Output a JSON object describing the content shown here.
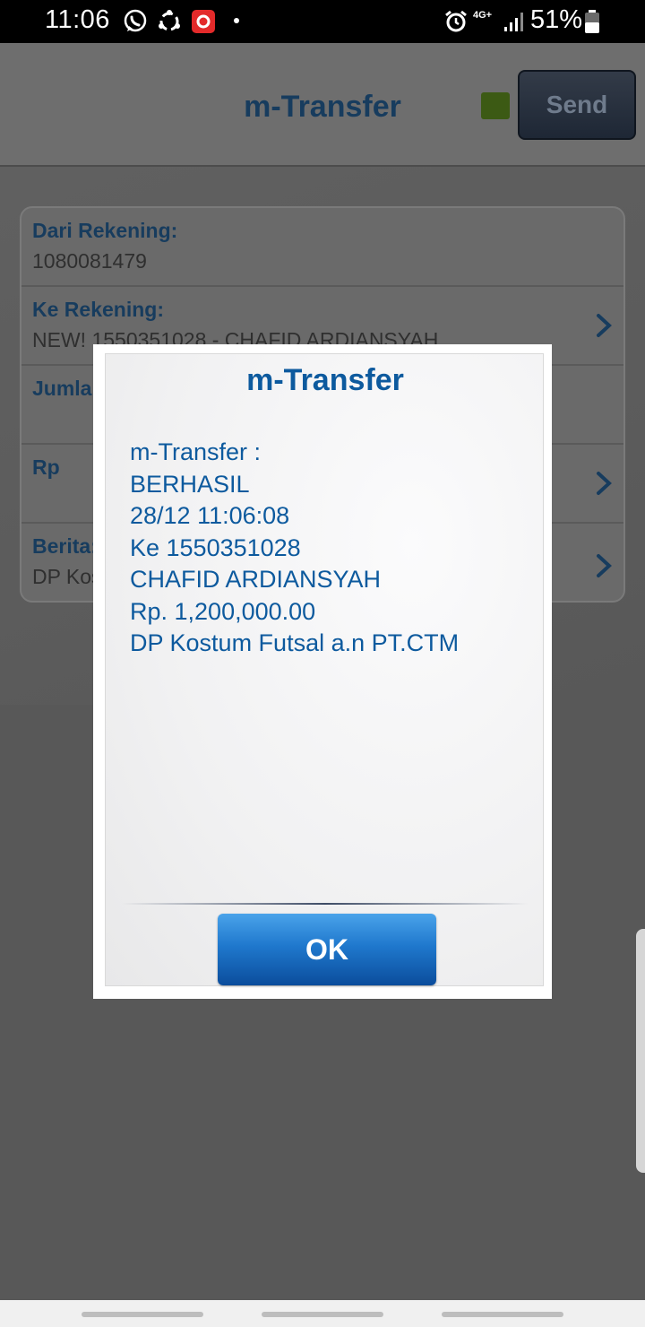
{
  "status_bar": {
    "time": "11:06",
    "battery": "51%",
    "network": "4G+",
    "icons": [
      "whatsapp-icon",
      "sync-icon",
      "recorder-icon",
      "alarm-icon",
      "signal-icon",
      "battery-icon"
    ]
  },
  "header": {
    "title": "m-Transfer",
    "send_label": "Send",
    "status_led_color": "#3c5a14"
  },
  "form": {
    "rows": [
      {
        "label": "Dari Rekening:",
        "value": "1080081479"
      },
      {
        "label": "Ke Rekening:",
        "value": "NEW! 1550351028 - CHAFID ARDIANSYAH"
      },
      {
        "label": "Jumlah:",
        "value": ""
      },
      {
        "label": "Rp",
        "value": ""
      },
      {
        "label": "Berita:",
        "value": "DP Kostum Futsal a.n PT.CTM"
      }
    ]
  },
  "dialog": {
    "title": "m-Transfer",
    "lines": [
      "m-Transfer :",
      "BERHASIL",
      "28/12 11:06:08",
      "Ke 1550351028",
      "CHAFID ARDIANSYAH",
      "Rp. 1,200,000.00",
      "DP Kostum Futsal a.n PT.CTM"
    ],
    "ok_label": "OK"
  },
  "colors": {
    "accent": "#0d5a9e",
    "overlay": "#585858"
  }
}
